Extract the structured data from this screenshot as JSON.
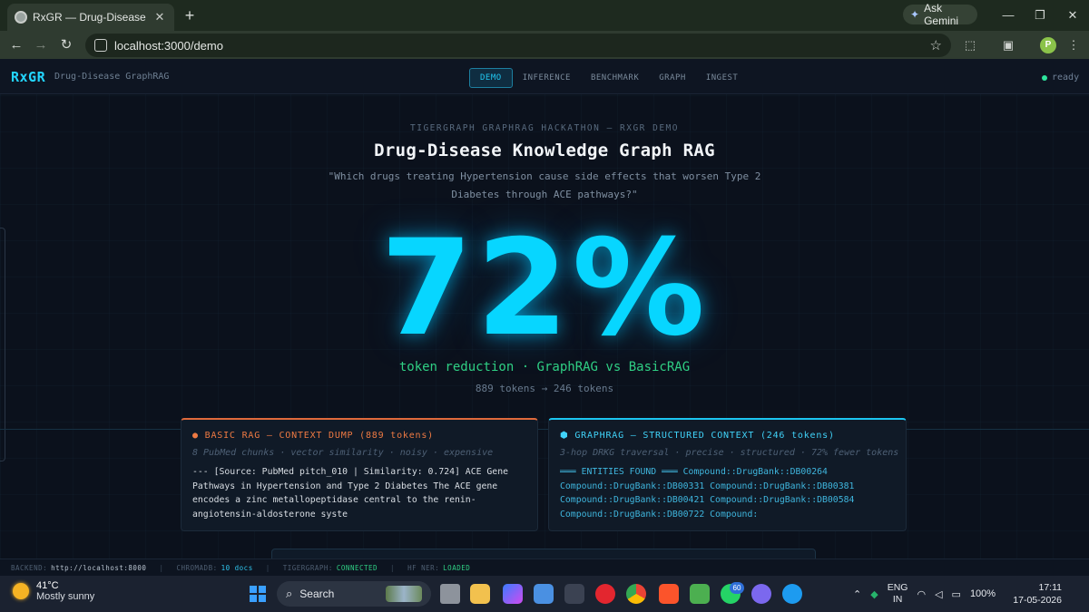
{
  "browser": {
    "tab_title": "RxGR — Drug-Disease GraphRAG",
    "tab_close": "✕",
    "new_tab": "+",
    "ask_gemini": "Ask Gemini",
    "url": "localhost:3000/demo",
    "profile_initial": "P"
  },
  "app": {
    "logo": "RxGR",
    "subtitle": "Drug-Disease GraphRAG",
    "nav": [
      {
        "label": "DEMO",
        "active": true
      },
      {
        "label": "INFERENCE",
        "active": false
      },
      {
        "label": "BENCHMARK",
        "active": false
      },
      {
        "label": "GRAPH",
        "active": false
      },
      {
        "label": "INGEST",
        "active": false
      }
    ],
    "status": "ready",
    "status_color": "#2ee59d"
  },
  "hero": {
    "eyebrow": "TIGERGRAPH GRAPHRAG HACKATHON — RXGR DEMO",
    "title": "Drug-Disease Knowledge Graph RAG",
    "question": "\"Which drugs treating Hypertension cause side effects that worsen Type 2 Diabetes through ACE pathways?\"",
    "big_value": "72%",
    "reduction_label": "token reduction · GraphRAG vs BasicRAG",
    "tokens_label": "889 tokens → 246 tokens",
    "accent_color": "#07d6ff"
  },
  "basic_rag": {
    "title": "● BASIC RAG — CONTEXT DUMP (889 tokens)",
    "subtitle": "8 PubMed chunks · vector similarity · noisy · expensive",
    "body": "--- [Source: PubMed pitch_010 | Similarity: 0.724] ACE Gene Pathways in Hypertension and Type 2 Diabetes The ACE gene encodes a zinc metallopeptidase central to the renin-angiotensin-aldosterone syste",
    "accent_color": "#e06a3c"
  },
  "graph_rag": {
    "title": "⬢ GRAPHRAG — STRUCTURED CONTEXT (246 tokens)",
    "subtitle": "3-hop DRKG traversal · precise · structured · 72% fewer tokens",
    "body": "═══ ENTITIES FOUND ═══ Compound::DrugBank::DB00264 Compound::DrugBank::DB00331 Compound::DrugBank::DB00381 Compound::DrugBank::DB00421 Compound::DrugBank::DB00584 Compound::DrugBank::DB00722 Compound:",
    "accent_color": "#1cc6f0"
  },
  "footer": {
    "backend_label": "BACKEND:",
    "backend_value": "http://localhost:8000",
    "chroma_label": "CHROMADB:",
    "chroma_value": "10 docs",
    "tiger_label": "TIGERGRAPH:",
    "tiger_value": "CONNECTED",
    "ner_label": "HF NER:",
    "ner_value": "LOADED",
    "sep": "|"
  },
  "taskbar": {
    "temp": "41°C",
    "weather": "Mostly sunny",
    "search": "Search",
    "whatsapp_badge": "60",
    "lang_top": "ENG",
    "lang_bottom": "IN",
    "battery": "100%",
    "time": "17:11",
    "date": "17-05-2026"
  }
}
